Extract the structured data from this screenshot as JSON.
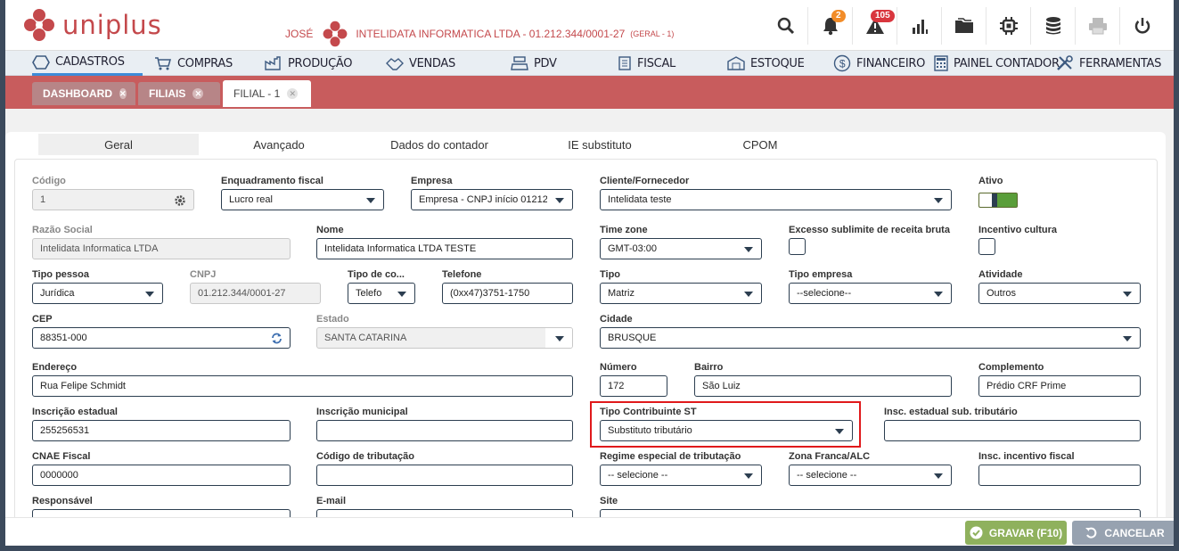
{
  "header": {
    "logo_text": "uniplus",
    "user": "JOSÉ",
    "company": "INTELIDATA INFORMATICA LTDA - 01.212.344/0001-27",
    "group": "(GERAL - 1)",
    "notifications_count": "2",
    "alerts_count": "105"
  },
  "nav": {
    "items": [
      {
        "label": "CADASTROS",
        "icon": "cube-icon"
      },
      {
        "label": "COMPRAS",
        "icon": "cart-icon"
      },
      {
        "label": "PRODUÇÃO",
        "icon": "factory-icon"
      },
      {
        "label": "VENDAS",
        "icon": "handshake-icon"
      },
      {
        "label": "PDV",
        "icon": "register-icon"
      },
      {
        "label": "FISCAL",
        "icon": "document-icon"
      },
      {
        "label": "ESTOQUE",
        "icon": "warehouse-icon"
      },
      {
        "label": "FINANCEIRO",
        "icon": "dollar-icon"
      },
      {
        "label": "PAINEL CONTADOR",
        "icon": "calculator-icon"
      },
      {
        "label": "FERRAMENTAS",
        "icon": "tools-icon"
      }
    ]
  },
  "open_tabs": [
    {
      "label": "DASHBOARD"
    },
    {
      "label": "FILIAIS"
    },
    {
      "label": "FILIAL - 1"
    }
  ],
  "inner_tabs": [
    "Geral",
    "Avançado",
    "Dados do contador",
    "IE substituto",
    "CPOM"
  ],
  "form": {
    "codigo": {
      "label": "Código",
      "value": "1"
    },
    "enquadramento": {
      "label": "Enquadramento fiscal",
      "value": "Lucro real"
    },
    "empresa": {
      "label": "Empresa",
      "value": "Empresa - CNPJ início 01212"
    },
    "cliente": {
      "label": "Cliente/Fornecedor",
      "value": "Intelidata teste"
    },
    "ativo": {
      "label": "Ativo",
      "value": true
    },
    "razao": {
      "label": "Razão Social",
      "value": "Intelidata Informatica LTDA"
    },
    "nome": {
      "label": "Nome",
      "value": "Intelidata Informatica LTDA TESTE"
    },
    "timezone": {
      "label": "Time zone",
      "value": "GMT-03:00"
    },
    "excesso": {
      "label": "Excesso sublimite de receita bruta"
    },
    "incentivo": {
      "label": "Incentivo cultura"
    },
    "tipo_pessoa": {
      "label": "Tipo pessoa",
      "value": "Jurídica"
    },
    "cnpj": {
      "label": "CNPJ",
      "value": "01.212.344/0001-27"
    },
    "tipo_contato": {
      "label": "Tipo de co...",
      "value": "Telefo"
    },
    "telefone": {
      "label": "Telefone",
      "value": "(0xx47)3751-1750"
    },
    "tipo": {
      "label": "Tipo",
      "value": "Matriz"
    },
    "tipo_empresa": {
      "label": "Tipo empresa",
      "value": "--selecione--"
    },
    "atividade": {
      "label": "Atividade",
      "value": "Outros"
    },
    "cep": {
      "label": "CEP",
      "value": "88351-000"
    },
    "estado": {
      "label": "Estado",
      "value": "SANTA CATARINA"
    },
    "cidade": {
      "label": "Cidade",
      "value": "BRUSQUE"
    },
    "endereco": {
      "label": "Endereço",
      "value": "Rua Felipe Schmidt"
    },
    "numero": {
      "label": "Número",
      "value": "172"
    },
    "bairro": {
      "label": "Bairro",
      "value": "São Luiz"
    },
    "complemento": {
      "label": "Complemento",
      "value": "Prédio CRF Prime"
    },
    "ie": {
      "label": "Inscrição estadual",
      "value": "255256531"
    },
    "im": {
      "label": "Inscrição municipal",
      "value": ""
    },
    "tipo_contrib": {
      "label": "Tipo Contribuinte ST",
      "value": "Substituto tributário"
    },
    "ie_sub": {
      "label": "Insc. estadual sub. tributário",
      "value": ""
    },
    "cnae": {
      "label": "CNAE Fiscal",
      "value": "0000000"
    },
    "cod_trib": {
      "label": "Código de tributação",
      "value": ""
    },
    "regime": {
      "label": "Regime especial de tributação",
      "value": "-- selecione --"
    },
    "zona": {
      "label": "Zona Franca/ALC",
      "value": "-- selecione --"
    },
    "insc_incentivo": {
      "label": "Insc. incentivo fiscal",
      "value": ""
    },
    "responsavel": {
      "label": "Responsável"
    },
    "email": {
      "label": "E-mail"
    },
    "site": {
      "label": "Site"
    }
  },
  "footer": {
    "save_label": "GRAVAR (F10)",
    "cancel_label": "CANCELAR"
  },
  "colors": {
    "brand": "#c4494c",
    "tab_bar": "#c85c5d",
    "save": "#8fb15d",
    "cancel": "#97a2b0",
    "highlight": "#e0191b"
  }
}
